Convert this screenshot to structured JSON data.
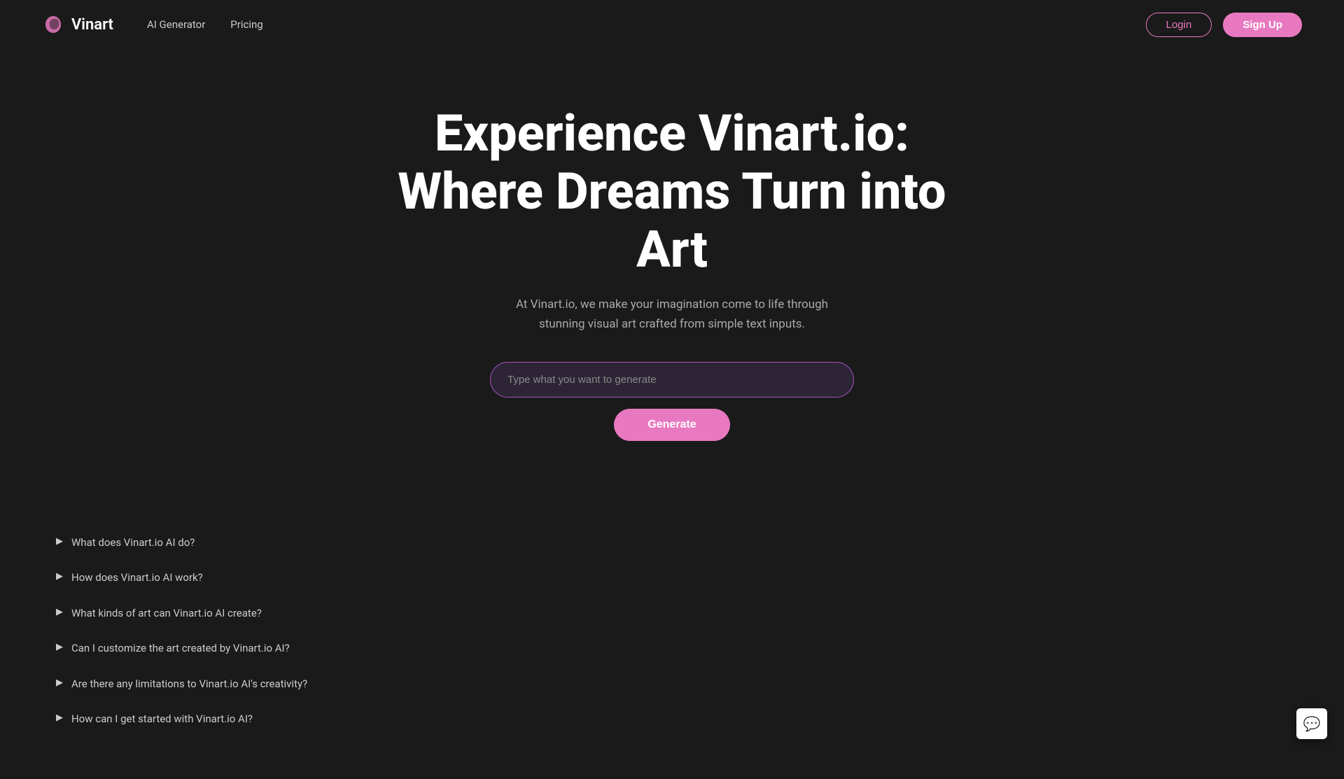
{
  "brand": {
    "name": "Vinart",
    "logo_icon": "🌀"
  },
  "navbar": {
    "links": [
      {
        "label": "AI Generator",
        "href": "#"
      },
      {
        "label": "Pricing",
        "href": "#"
      }
    ],
    "login_label": "Login",
    "signup_label": "Sign Up"
  },
  "hero": {
    "title": "Experience Vinart.io: Where Dreams Turn into Art",
    "subtitle": "At Vinart.io, we make your imagination come to life through stunning visual art crafted from simple text inputs."
  },
  "generator": {
    "input_placeholder": "Type what you want to generate",
    "generate_button_label": "Generate"
  },
  "faq": {
    "items": [
      {
        "question": "What does Vinart.io AI do?"
      },
      {
        "question": "How does Vinart.io AI work?"
      },
      {
        "question": "What kinds of art can Vinart.io AI create?"
      },
      {
        "question": "Can I customize the art created by Vinart.io AI?"
      },
      {
        "question": "Are there any limitations to Vinart.io AI's creativity?"
      },
      {
        "question": "How can I get started with Vinart.io AI?"
      }
    ]
  },
  "colors": {
    "brand_pink": "#e879c0",
    "background": "#1a1a1a",
    "input_bg": "#2d2535",
    "border_purple": "#a855c8"
  }
}
